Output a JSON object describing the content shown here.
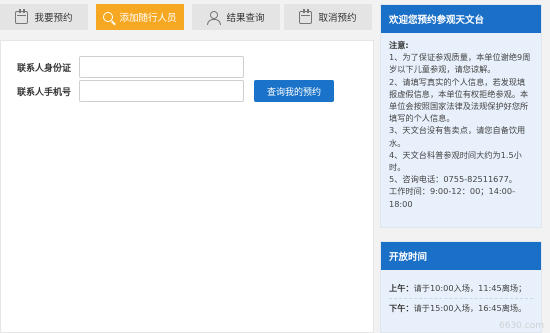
{
  "tabs": [
    {
      "label": "我要预约",
      "icon": "calendar-icon"
    },
    {
      "label": "添加随行人员",
      "icon": "search-icon"
    },
    {
      "label": "结果查询",
      "icon": "user-icon"
    },
    {
      "label": "取消预约",
      "icon": "calendar-cancel-icon"
    }
  ],
  "form": {
    "id_label": "联系人身份证",
    "id_value": "",
    "phone_label": "联系人手机号",
    "phone_value": "",
    "query_button": "查询我的预约"
  },
  "notice_panel": {
    "title": "欢迎您预约参观天文台",
    "heading": "注意:",
    "items": [
      "1、为了保证参观质量，本单位谢绝9周岁以下儿童参观，请您谅解。",
      "2、请填写真实的个人信息，若发现填报虚假信息，本单位有权拒绝参观。本单位会按照国家法律及法规保护好您所填写的个人信息。",
      "3、天文台没有售卖点，请您自备饮用水。",
      "4、天文台科普参观时间大约为1.5小时。",
      "5、咨询电话：0755-82511677。",
      "工作时间：9:00-12：00；14:00-18:00"
    ]
  },
  "hours_panel": {
    "title": "开放时间",
    "morning_label": "上午：",
    "morning_text": "请于10:00入场，11:45离场；",
    "afternoon_label": "下午：",
    "afternoon_text": "请于15:00入场，16:45离场。"
  },
  "watermark": "6630.com",
  "colors": {
    "accent_orange": "#f7a823",
    "primary_blue": "#1a6fc7",
    "panel_bg": "#e8f1fb"
  }
}
